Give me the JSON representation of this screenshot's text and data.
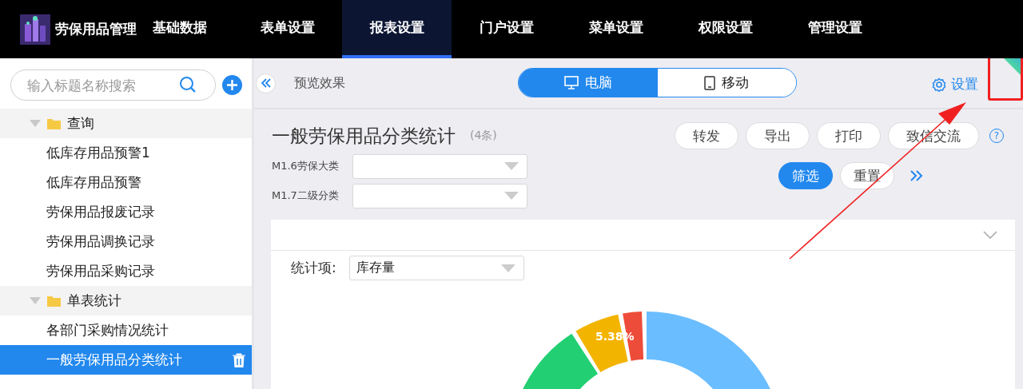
{
  "app": {
    "title": "劳保用品管理"
  },
  "nav": [
    {
      "label": "基础数据",
      "selected": false
    },
    {
      "label": "表单设置",
      "selected": false
    },
    {
      "label": "报表设置",
      "selected": true
    },
    {
      "label": "门户设置",
      "selected": false
    },
    {
      "label": "菜单设置",
      "selected": false
    },
    {
      "label": "权限设置",
      "selected": false
    },
    {
      "label": "管理设置",
      "selected": false
    }
  ],
  "sidebar": {
    "search": {
      "placeholder": "输入标题名称搜索"
    },
    "groups": [
      {
        "label": "查询",
        "expanded": true,
        "children": [
          {
            "label": "低库存用品预警1",
            "selected": false
          },
          {
            "label": "低库存用品预警",
            "selected": false
          },
          {
            "label": "劳保用品报废记录",
            "selected": false
          },
          {
            "label": "劳保用品调换记录",
            "selected": false
          },
          {
            "label": "劳保用品采购记录",
            "selected": false
          }
        ]
      },
      {
        "label": "单表统计",
        "expanded": true,
        "children": [
          {
            "label": "各部门采购情况统计",
            "selected": false
          },
          {
            "label": "一般劳保用品分类统计",
            "selected": true
          }
        ]
      }
    ]
  },
  "toolbar": {
    "preview_label": "预览效果",
    "modes": [
      {
        "label": "电脑",
        "kind": "desktop",
        "selected": true
      },
      {
        "label": "移动",
        "kind": "mobile",
        "selected": false
      }
    ],
    "settings_label": "设置"
  },
  "report": {
    "title": "一般劳保用品分类统计",
    "count": "(4条)",
    "actions": [
      "转发",
      "导出",
      "打印",
      "致信交流"
    ],
    "help": "?",
    "filters": [
      {
        "label": "M1.6劳保大类"
      },
      {
        "label": "M1.7二级分类"
      }
    ],
    "filter_buttons": [
      {
        "label": "筛选",
        "kind": "primary"
      },
      {
        "label": "重置",
        "kind": "default"
      }
    ],
    "stat_label": "统计项:",
    "stat_value": "库存量",
    "slice_label": "5.38%"
  }
}
